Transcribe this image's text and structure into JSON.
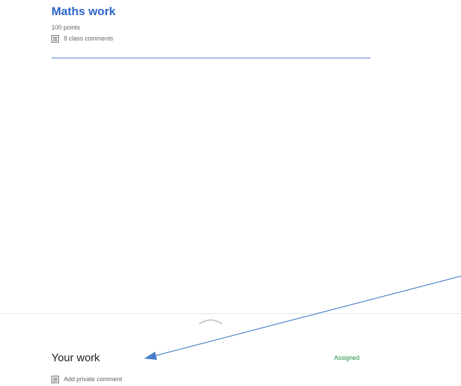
{
  "assignment": {
    "title": "Maths work",
    "points": "100 points",
    "class_comments": "8 class comments"
  },
  "your_work": {
    "title": "Your work",
    "status": "Assigned",
    "private_comment_label": "Add private comment"
  },
  "icons": {
    "comment": "comment-icon",
    "private_comment": "comment-icon",
    "handle": "chevron-up-icon",
    "annotation": "arrow-annotation"
  },
  "colors": {
    "title_blue": "#2b64c9",
    "status_green": "#1e8e3e",
    "arrow_blue": "#4a7fc9",
    "text_gray": "#5f6368"
  }
}
